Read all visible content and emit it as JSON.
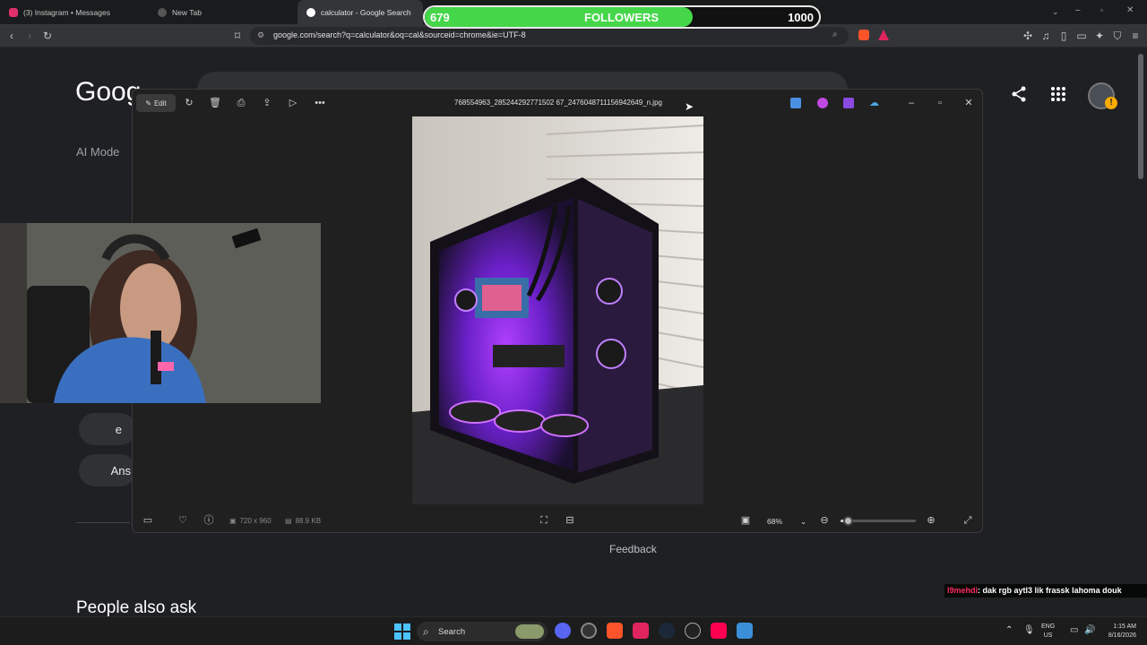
{
  "browser": {
    "tabs": [
      {
        "title": "(3) Instagram • Messages",
        "icon": "instagram-icon",
        "color": "#e1306c"
      },
      {
        "title": "New Tab",
        "icon": "shield-icon",
        "color": "#777777"
      },
      {
        "title": "calculator - Google Search",
        "icon": "google-icon",
        "color": "#ffffff"
      }
    ],
    "url": "google.com/search?q=calculator&oq=cal&sourceid=chrome&ie=UTF-8"
  },
  "followers_widget": {
    "current": "679",
    "label": "FOLLOWERS",
    "goal": "1000",
    "progress": 0.679,
    "fill_color": "#46d64a"
  },
  "google": {
    "logo": "Goog",
    "ai_mode": "AI Mode",
    "pills": [
      "e",
      "Ans"
    ],
    "feedback": "Feedback",
    "people_also_ask": "People also ask"
  },
  "viewer": {
    "edit_label": "Edit",
    "filename": "768554963_285244292771502 67_2476048711156942649_n.jpg",
    "dimensions": "720 x 960",
    "file_size": "88.9 KB",
    "zoom": "68%",
    "zoom_level": 0.1
  },
  "chat": {
    "user": "l9mehdi",
    "message": ": dak rgb aytl3 lik frassk lahoma douk"
  },
  "taskbar": {
    "search_placeholder": "Search",
    "lang_top": "ENG",
    "lang_bottom": "US",
    "time": "1:15 AM",
    "date": "8/16/2026"
  }
}
